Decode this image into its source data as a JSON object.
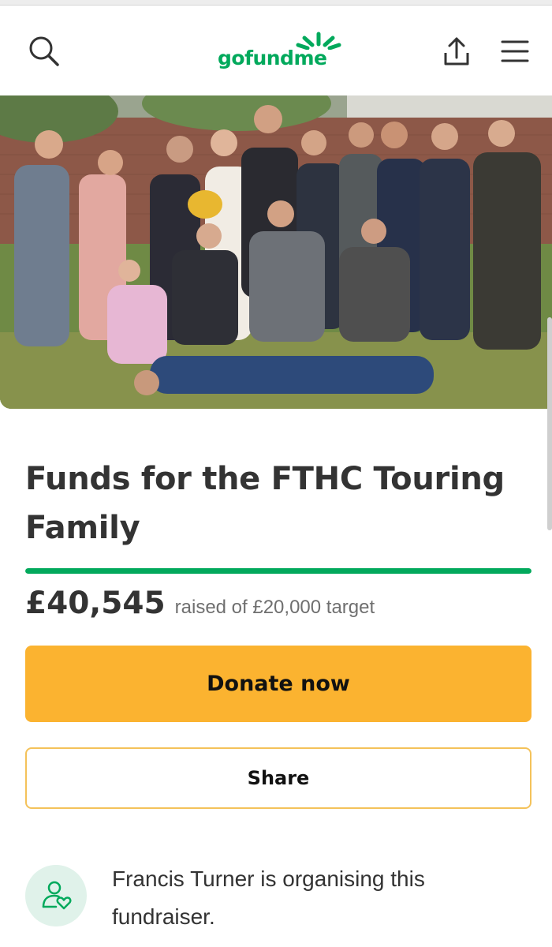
{
  "header": {
    "logo_text": "gofundme",
    "icons": [
      "search-icon",
      "share-upload-icon",
      "menu-icon"
    ],
    "brand_color": "#02a95c"
  },
  "hero": {
    "image": "group-photo-wedding-party"
  },
  "campaign": {
    "title": "Funds for the FTHC Touring Family",
    "raised": "£40,545",
    "raised_suffix": "raised of £20,000 target",
    "progress_fraction": 1.0
  },
  "actions": {
    "donate_label": "Donate now",
    "donate_color": "#fbb330",
    "share_label": "Share"
  },
  "organiser": {
    "icon": "organiser-heart-icon",
    "text": "Francis Turner is organising this fundraiser."
  }
}
